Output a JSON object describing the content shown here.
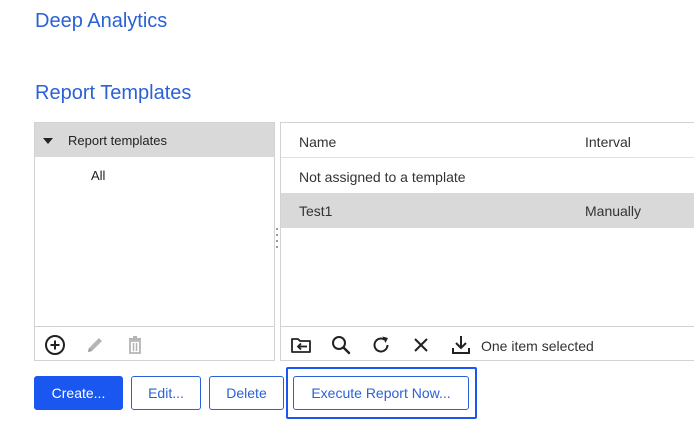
{
  "app": {
    "title": "Deep Analytics"
  },
  "section": {
    "title": "Report Templates"
  },
  "tree": {
    "root_label": "Report templates",
    "children": [
      {
        "label": "All"
      }
    ]
  },
  "left_toolbar": {
    "icons": [
      "add-circle-icon",
      "pencil-icon",
      "trash-icon"
    ]
  },
  "list": {
    "columns": {
      "name": "Name",
      "interval": "Interval"
    },
    "rows": [
      {
        "name": "Not assigned to a template",
        "interval": "",
        "selected": false
      },
      {
        "name": "Test1",
        "interval": "Manually",
        "selected": true
      }
    ]
  },
  "right_toolbar": {
    "icons": [
      "move-to-folder-icon",
      "search-icon",
      "refresh-icon",
      "close-icon",
      "download-icon"
    ],
    "status": "One item selected"
  },
  "buttons": {
    "create": "Create...",
    "edit": "Edit...",
    "delete": "Delete",
    "execute": "Execute Report Now..."
  },
  "colors": {
    "accent": "#2a62d6",
    "primary_button": "#1a56f0",
    "selected_row": "#d9d9d9"
  }
}
